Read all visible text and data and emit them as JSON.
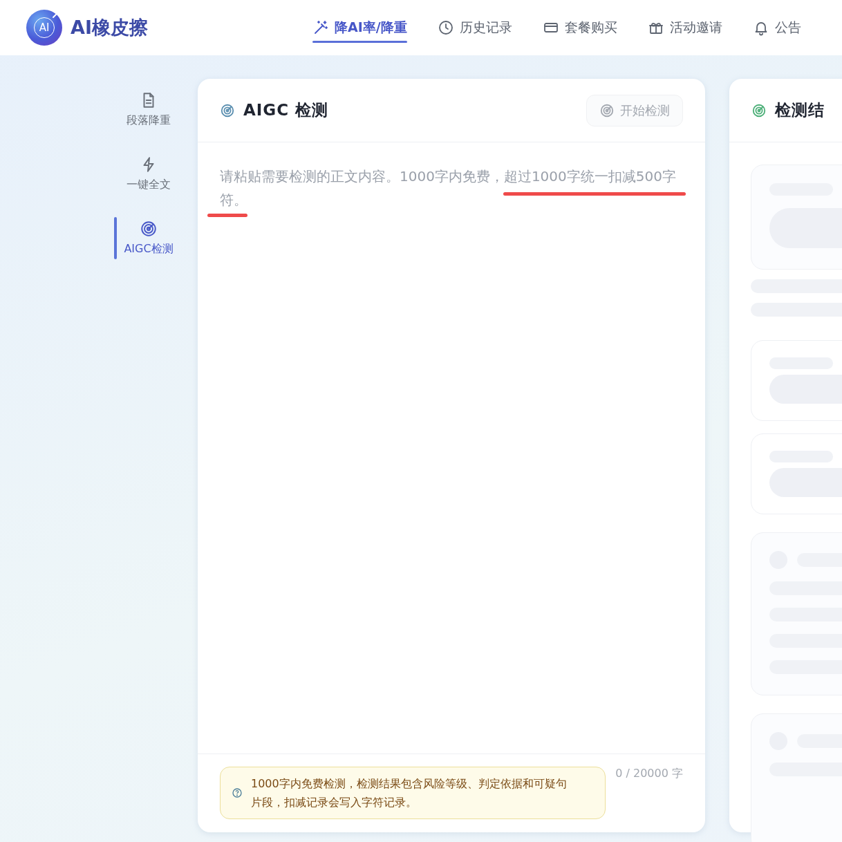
{
  "app": {
    "logo_text": "AI",
    "name": "AI橡皮擦"
  },
  "nav": [
    {
      "label": "降AI率/降重",
      "selected": true
    },
    {
      "label": "历史记录",
      "selected": false
    },
    {
      "label": "套餐购买",
      "selected": false
    },
    {
      "label": "活动邀请",
      "selected": false
    },
    {
      "label": "公告",
      "selected": false
    }
  ],
  "sidebar": [
    {
      "label": "段落降重",
      "selected": false
    },
    {
      "label": "一键全文",
      "selected": false
    },
    {
      "label": "AIGC检测",
      "selected": true
    }
  ],
  "detect_panel": {
    "title": "AIGC 检测",
    "start_button": "开始检测",
    "input": {
      "placeholder": "请粘贴需要检测的正文内容。1000字内免费，超过1000字统一扣减500字符。"
    },
    "notice": "1000字内免费检测，检测结果包含风险等级、判定依据和可疑句片段，扣减记录会写入字符记录。",
    "counter": "0 / 20000 字"
  },
  "result_panel": {
    "title": "检测结"
  }
}
